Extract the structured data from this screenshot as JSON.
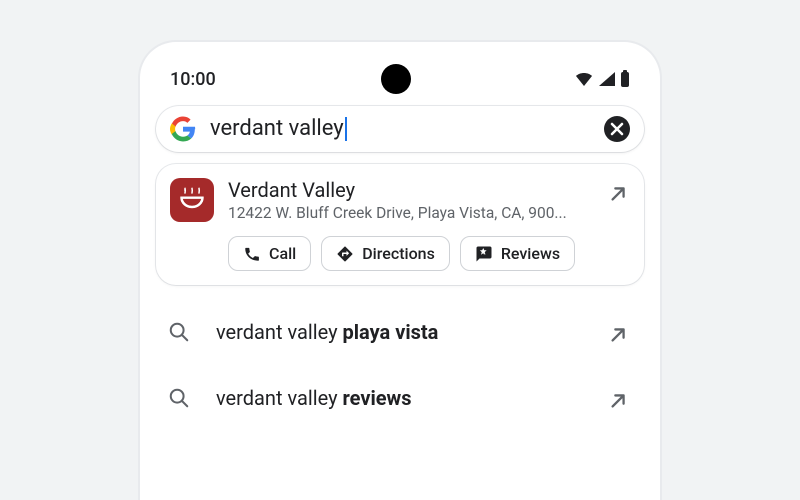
{
  "status": {
    "time": "10:00"
  },
  "search": {
    "query": "verdant valley"
  },
  "result": {
    "title": "Verdant Valley",
    "address": "12422 W. Bluff Creek Drive, Playa Vista, CA, 900...",
    "actions": {
      "call": "Call",
      "directions": "Directions",
      "reviews": "Reviews"
    }
  },
  "suggestions": [
    {
      "prefix": "verdant valley ",
      "highlight": "playa vista"
    },
    {
      "prefix": "verdant valley ",
      "highlight": "reviews"
    }
  ]
}
